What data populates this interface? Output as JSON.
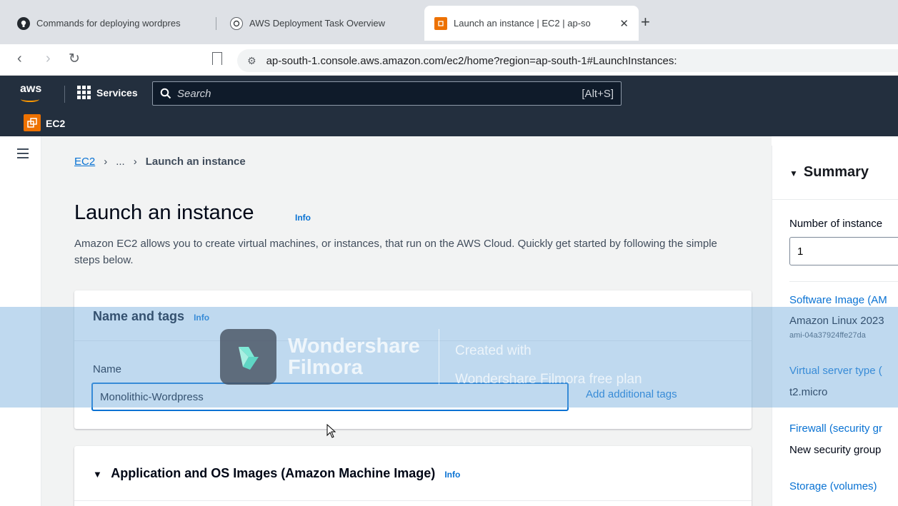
{
  "browser": {
    "tabs": [
      {
        "label": "Commands for deploying wordpres"
      },
      {
        "label": "AWS Deployment Task Overview"
      },
      {
        "label": "Launch an instance | EC2 | ap-so"
      }
    ],
    "url": "ap-south-1.console.aws.amazon.com/ec2/home?region=ap-south-1#LaunchInstances:"
  },
  "aws": {
    "logo": "aws",
    "services_label": "Services",
    "search_placeholder": "Search",
    "search_shortcut": "[Alt+S]",
    "service_name": "EC2",
    "accent_color": "#ff9900"
  },
  "breadcrumb": {
    "root": "EC2",
    "middle": "...",
    "current": "Launch an instance"
  },
  "page": {
    "title": "Launch an instance",
    "info": "Info",
    "description": "Amazon EC2 allows you to create virtual machines, or instances, that run on the AWS Cloud. Quickly get started by following the simple steps below."
  },
  "name_tags": {
    "heading": "Name and tags",
    "info": "Info",
    "name_label": "Name",
    "name_value": "Monolithic-Wordpress",
    "add_tags": "Add additional tags"
  },
  "ami": {
    "heading": "Application and OS Images (Amazon Machine Image)",
    "info": "Info"
  },
  "summary": {
    "title": "Summary",
    "instances_label": "Number of instance",
    "instances_value": "1",
    "software_image_label": "Software Image (AM",
    "software_image_value": "Amazon Linux 2023",
    "software_image_id": "ami-04a37924ffe27da",
    "server_type_label": "Virtual server type (",
    "server_type_value": "t2.micro",
    "firewall_label": "Firewall (security gr",
    "firewall_value": "New security group",
    "storage_label": "Storage (volumes)"
  },
  "watermark": {
    "brand_line1": "Wondershare",
    "brand_line2": "Filmora",
    "created_line1": "Created with",
    "created_line2": "Wondershare Filmora free plan"
  }
}
